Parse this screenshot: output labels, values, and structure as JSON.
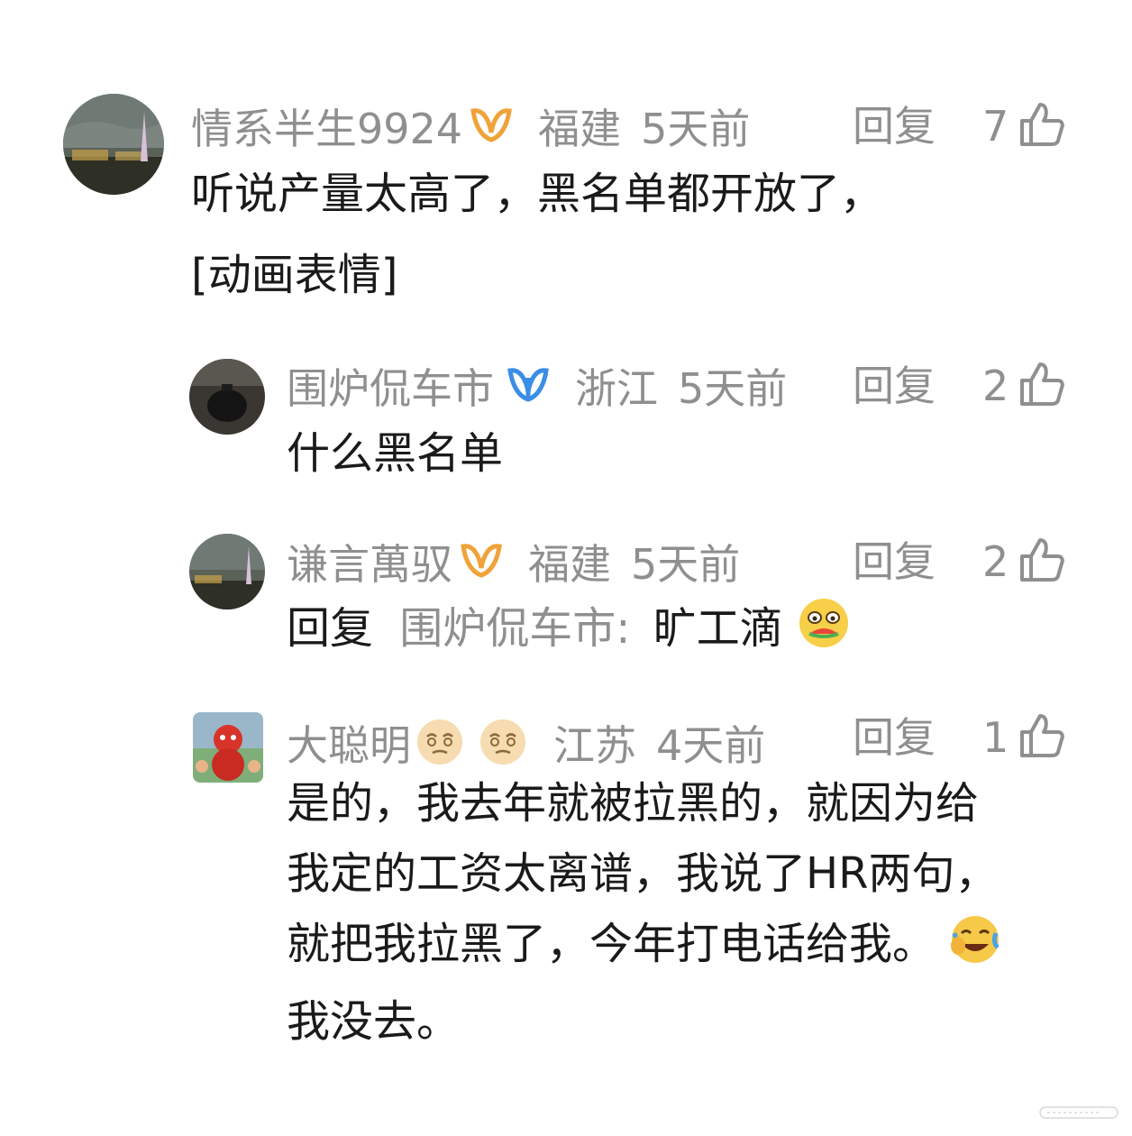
{
  "comments": [
    {
      "user": "情系半生9924",
      "location": "福建",
      "time": "5天前",
      "reply_label": "回复",
      "likes": "7",
      "text_line1": "听说产量太高了，黑名单都开放了，",
      "text_line2": "[动画表情]"
    },
    {
      "user": "围炉侃车市",
      "location": "浙江",
      "time": "5天前",
      "reply_label": "回复",
      "likes": "2",
      "text_line1": "什么黑名单"
    },
    {
      "user": "谦言萬驭",
      "location": "福建",
      "time": "5天前",
      "reply_label": "回复",
      "likes": "2",
      "reply_prefix": "回复",
      "reply_target": "围炉侃车市:",
      "text_line1": "旷工滴"
    },
    {
      "user": "大聪明",
      "location": "江苏",
      "time": "4天前",
      "reply_label": "回复",
      "likes": "1",
      "text_line1": "是的，我去年就被拉黑的，就因为给",
      "text_line2": "我定的工资太离谱，我说了HR两句，",
      "text_line3": "就把我拉黑了，今年打电话给我。",
      "text_line4": "我没去。"
    }
  ],
  "colors": {
    "meta": "#8f8f8f",
    "text": "#1a1a1a",
    "vip_orange": "#f0a23a",
    "vip_blue": "#3a8ee6"
  }
}
